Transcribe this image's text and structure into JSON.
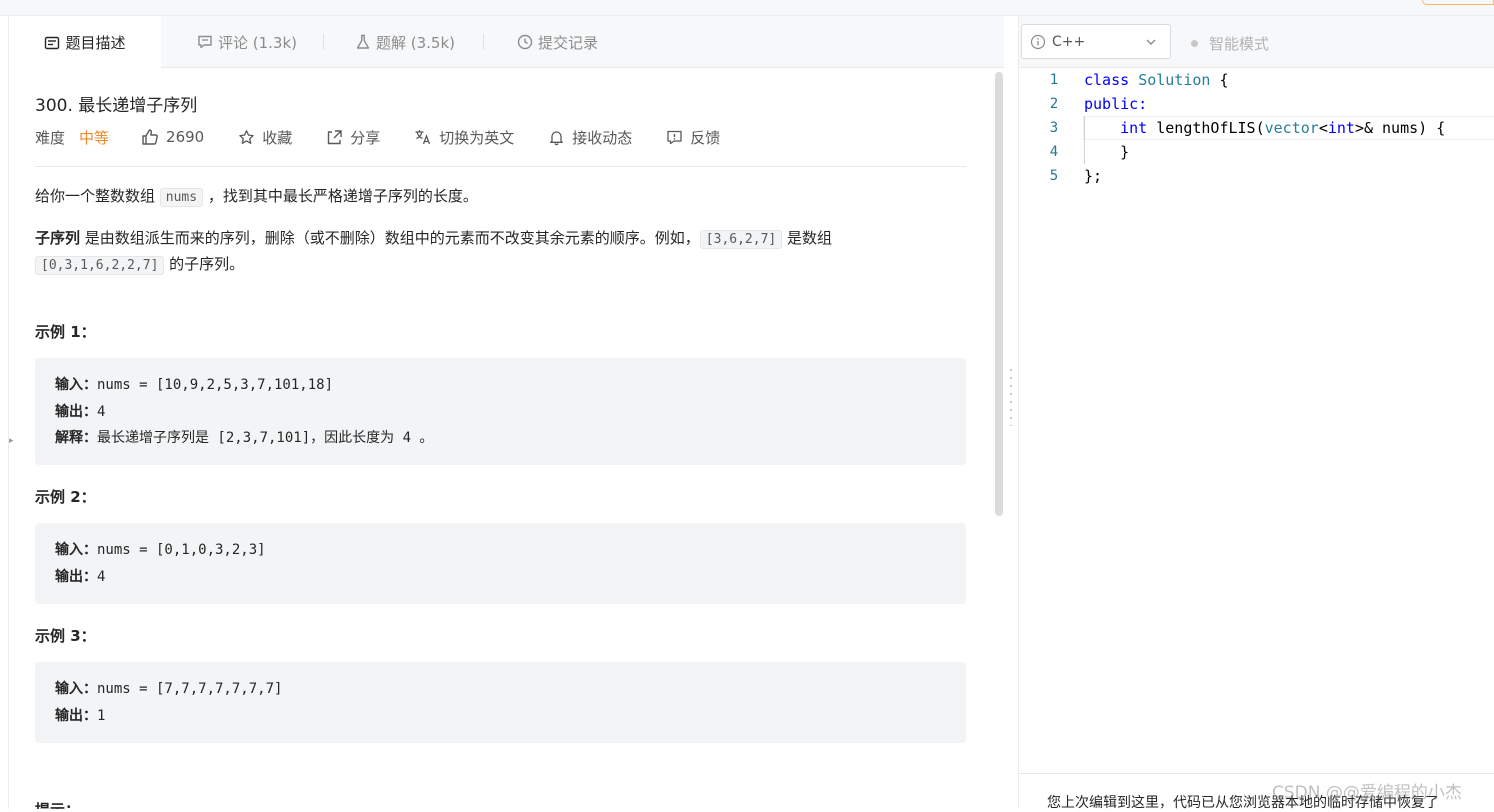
{
  "tabs": [
    {
      "label": "题目描述",
      "icon": "description-icon",
      "active": true
    },
    {
      "label": "评论 (1.3k)",
      "icon": "comment-icon",
      "active": false
    },
    {
      "label": "题解 (3.5k)",
      "icon": "flask-icon",
      "active": false
    },
    {
      "label": "提交记录",
      "icon": "clock-icon",
      "active": false
    }
  ],
  "problem": {
    "title": "300. 最长递增子序列",
    "difficulty_label": "难度",
    "difficulty": "中等",
    "likes": "2690",
    "collect": "收藏",
    "share": "分享",
    "switch_lang": "切换为英文",
    "subscribe": "接收动态",
    "feedback": "反馈"
  },
  "description": {
    "p1_a": "给你一个整数数组 ",
    "p1_code": "nums",
    "p1_b": " ，找到其中最长严格递增子序列的长度。",
    "p2_bold": "子序列",
    "p2_a": " 是由数组派生而来的序列，删除（或不删除）数组中的元素而不改变其余元素的顺序。例如，",
    "p2_code1": "[3,6,2,7]",
    "p2_b": " 是数组",
    "p2_code2": "[0,3,1,6,2,2,7]",
    "p2_c": " 的子序列。"
  },
  "examples": [
    {
      "title": "示例 1：",
      "input_label": "输入：",
      "input": "nums = [10,9,2,5,3,7,101,18]",
      "output_label": "输出：",
      "output": "4",
      "explain_label": "解释：",
      "explain": "最长递增子序列是 [2,3,7,101]，因此长度为 4 。"
    },
    {
      "title": "示例 2：",
      "input_label": "输入：",
      "input": "nums = [0,1,0,3,2,3]",
      "output_label": "输出：",
      "output": "4"
    },
    {
      "title": "示例 3：",
      "input_label": "输入：",
      "input": "nums = [7,7,7,7,7,7,7]",
      "output_label": "输出：",
      "output": "1"
    }
  ],
  "tips_title": "提示：",
  "editor": {
    "language": "C++",
    "smart_mode": "智能模式",
    "lines": [
      {
        "n": "1",
        "parts": [
          {
            "t": "class",
            "c": "kw"
          },
          {
            "t": " "
          },
          {
            "t": "Solution",
            "c": "ty"
          },
          {
            "t": " {"
          }
        ]
      },
      {
        "n": "2",
        "parts": [
          {
            "t": "public:",
            "c": "kw"
          }
        ]
      },
      {
        "n": "3",
        "parts": [
          {
            "t": "    "
          },
          {
            "t": "int",
            "c": "kw"
          },
          {
            "t": " lengthOfLIS("
          },
          {
            "t": "vector",
            "c": "ty"
          },
          {
            "t": "<"
          },
          {
            "t": "int",
            "c": "kw"
          },
          {
            "t": ">& nums) {"
          }
        ]
      },
      {
        "n": "4",
        "parts": [
          {
            "t": "    }"
          }
        ]
      },
      {
        "n": "5",
        "parts": [
          {
            "t": "};"
          }
        ]
      }
    ],
    "restore_message": "您上次编辑到这里，代码已从您浏览器本地的临时存储中恢复了"
  },
  "watermark": "CSDN @@爱编程的小杰"
}
